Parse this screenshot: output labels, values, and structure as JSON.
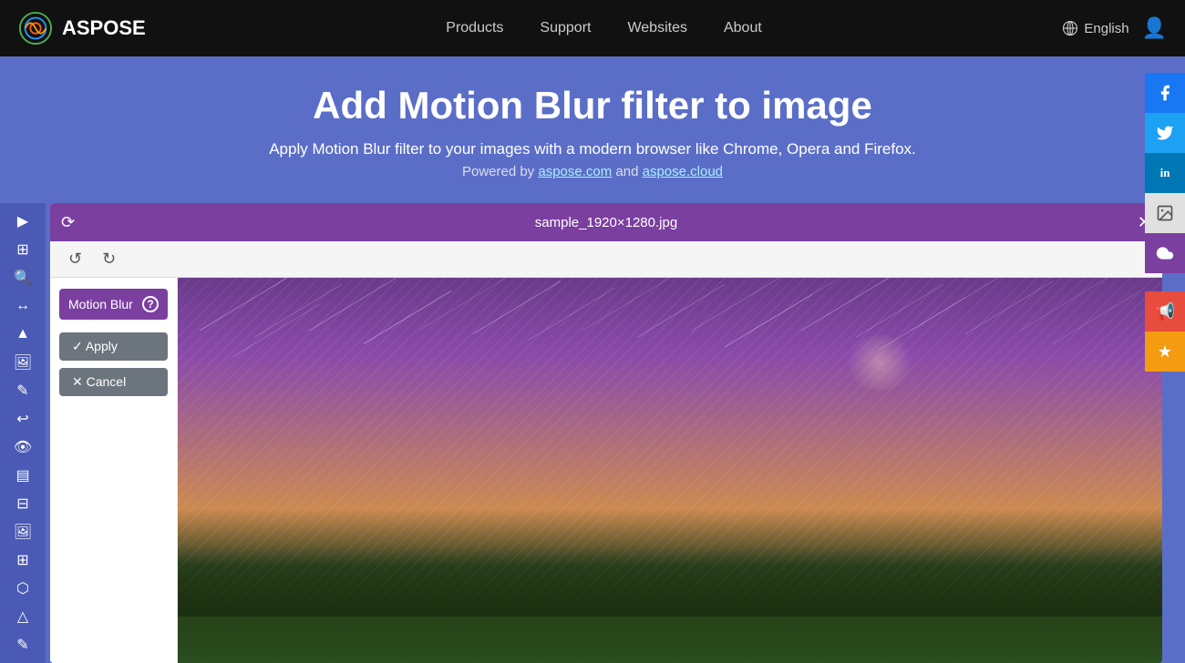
{
  "navbar": {
    "brand": "ASPOSE",
    "nav_items": [
      {
        "label": "Products",
        "id": "products"
      },
      {
        "label": "Support",
        "id": "support"
      },
      {
        "label": "Websites",
        "id": "websites"
      },
      {
        "label": "About",
        "id": "about"
      }
    ],
    "language": "English",
    "language_icon": "globe-icon",
    "user_icon": "user-icon"
  },
  "header": {
    "title": "Add Motion Blur filter to image",
    "subtitle": "Apply Motion Blur filter to your images with a modern browser like Chrome, Opera and Firefox.",
    "powered_by_text": "Powered by",
    "link1_text": "aspose.com",
    "link2_text": "aspose.cloud",
    "and_text": "and"
  },
  "editor": {
    "filename": "sample_1920×1280.jpg",
    "filter_title": "Motion Blur",
    "help_label": "?",
    "apply_label": "✓ Apply",
    "cancel_label": "✕ Cancel",
    "undo_icon": "↺",
    "redo_icon": "↻",
    "reset_icon": "⟳"
  },
  "toolbar": {
    "items": [
      {
        "icon": "▶",
        "name": "play"
      },
      {
        "icon": "⊞",
        "name": "grid"
      },
      {
        "icon": "🔍",
        "name": "zoom"
      },
      {
        "icon": "↔",
        "name": "resize"
      },
      {
        "icon": "🏔",
        "name": "landscape"
      },
      {
        "icon": "🖼",
        "name": "frame"
      },
      {
        "icon": "✎",
        "name": "draw"
      },
      {
        "icon": "↩",
        "name": "rotate"
      },
      {
        "icon": "👁",
        "name": "view"
      },
      {
        "icon": "▤",
        "name": "list"
      },
      {
        "icon": "⊟",
        "name": "subtract"
      },
      {
        "icon": "🖼",
        "name": "image2"
      },
      {
        "icon": "⊞",
        "name": "grid2"
      },
      {
        "icon": "⬡",
        "name": "shape"
      },
      {
        "icon": "🏔",
        "name": "mountain"
      },
      {
        "icon": "✎",
        "name": "edit2"
      }
    ]
  },
  "social": {
    "items": [
      {
        "label": "Facebook",
        "class": "fb",
        "icon": "f"
      },
      {
        "label": "Twitter",
        "class": "tw",
        "icon": "t"
      },
      {
        "label": "LinkedIn",
        "class": "li",
        "icon": "in"
      },
      {
        "label": "Image share",
        "class": "img",
        "icon": "img"
      },
      {
        "label": "Cloud",
        "class": "cloud",
        "icon": "☁"
      },
      {
        "label": "Announce",
        "class": "announce",
        "icon": "📢"
      },
      {
        "label": "Star",
        "class": "star",
        "icon": "★"
      }
    ]
  }
}
